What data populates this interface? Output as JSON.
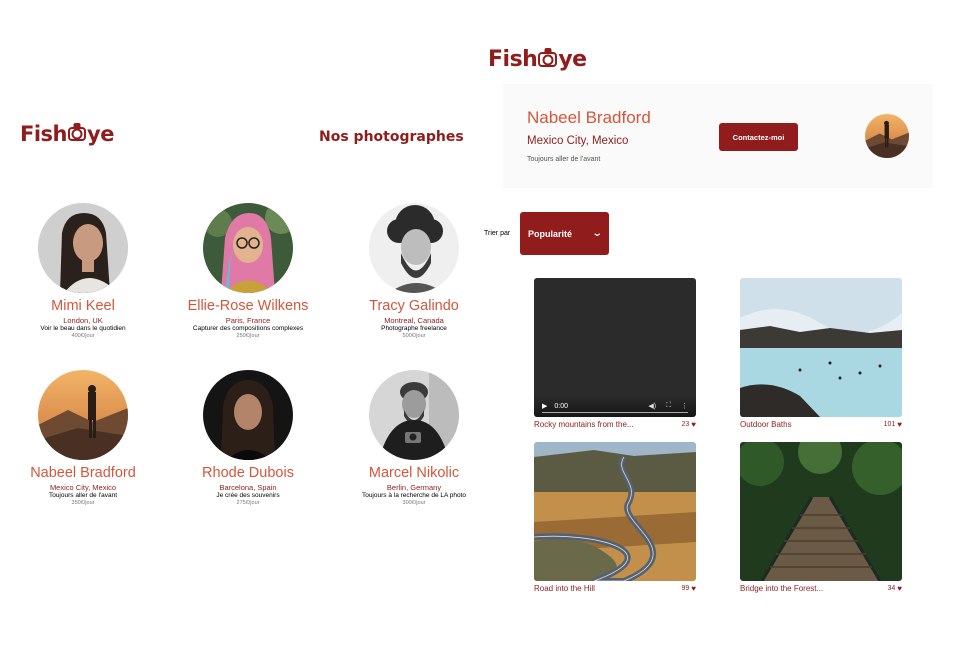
{
  "left": {
    "logo": {
      "pre": "Fish",
      "post": "ye"
    },
    "heading": "Nos photographes",
    "photographers": [
      {
        "name": "Mimi Keel",
        "location": "London, UK",
        "tagline": "Voir le beau dans le quotidien",
        "price": "400€/jour"
      },
      {
        "name": "Ellie-Rose Wilkens",
        "location": "Paris, France",
        "tagline": "Capturer des compositions complexes",
        "price": "250€/jour"
      },
      {
        "name": "Tracy Galindo",
        "location": "Montreal, Canada",
        "tagline": "Photographe freelance",
        "price": "500€/jour"
      },
      {
        "name": "Nabeel Bradford",
        "location": "Mexico City, Mexico",
        "tagline": "Toujours aller de l'avant",
        "price": "350€/jour"
      },
      {
        "name": "Rhode Dubois",
        "location": "Barcelona, Spain",
        "tagline": "Je crée des souvenirs",
        "price": "275€/jour"
      },
      {
        "name": "Marcel Nikolic",
        "location": "Berlin, Germany",
        "tagline": "Toujours à la recherche de LA photo",
        "price": "300€/jour"
      }
    ]
  },
  "right": {
    "logo": {
      "pre": "Fish",
      "post": "ye"
    },
    "photographer": {
      "name": "Nabeel Bradford",
      "location": "Mexico City, Mexico",
      "tagline": "Toujours aller de l'avant",
      "contact_label": "Contactez-moi"
    },
    "sort": {
      "label": "Trier par",
      "selected": "Popularité",
      "chevron": "chevron-down-icon"
    },
    "video_controls": {
      "time": "0:00"
    },
    "media": [
      {
        "title": "Rocky mountains from the...",
        "likes": "23",
        "type": "video"
      },
      {
        "title": "Outdoor Baths",
        "likes": "101",
        "type": "image"
      },
      {
        "title": "Road into the Hill",
        "likes": "99",
        "type": "image"
      },
      {
        "title": "Bridge into the Forest...",
        "likes": "34",
        "type": "image"
      }
    ]
  },
  "colors": {
    "primary": "#901C1C",
    "secondary": "#D3573C",
    "header_bg": "#FAFAFA"
  }
}
